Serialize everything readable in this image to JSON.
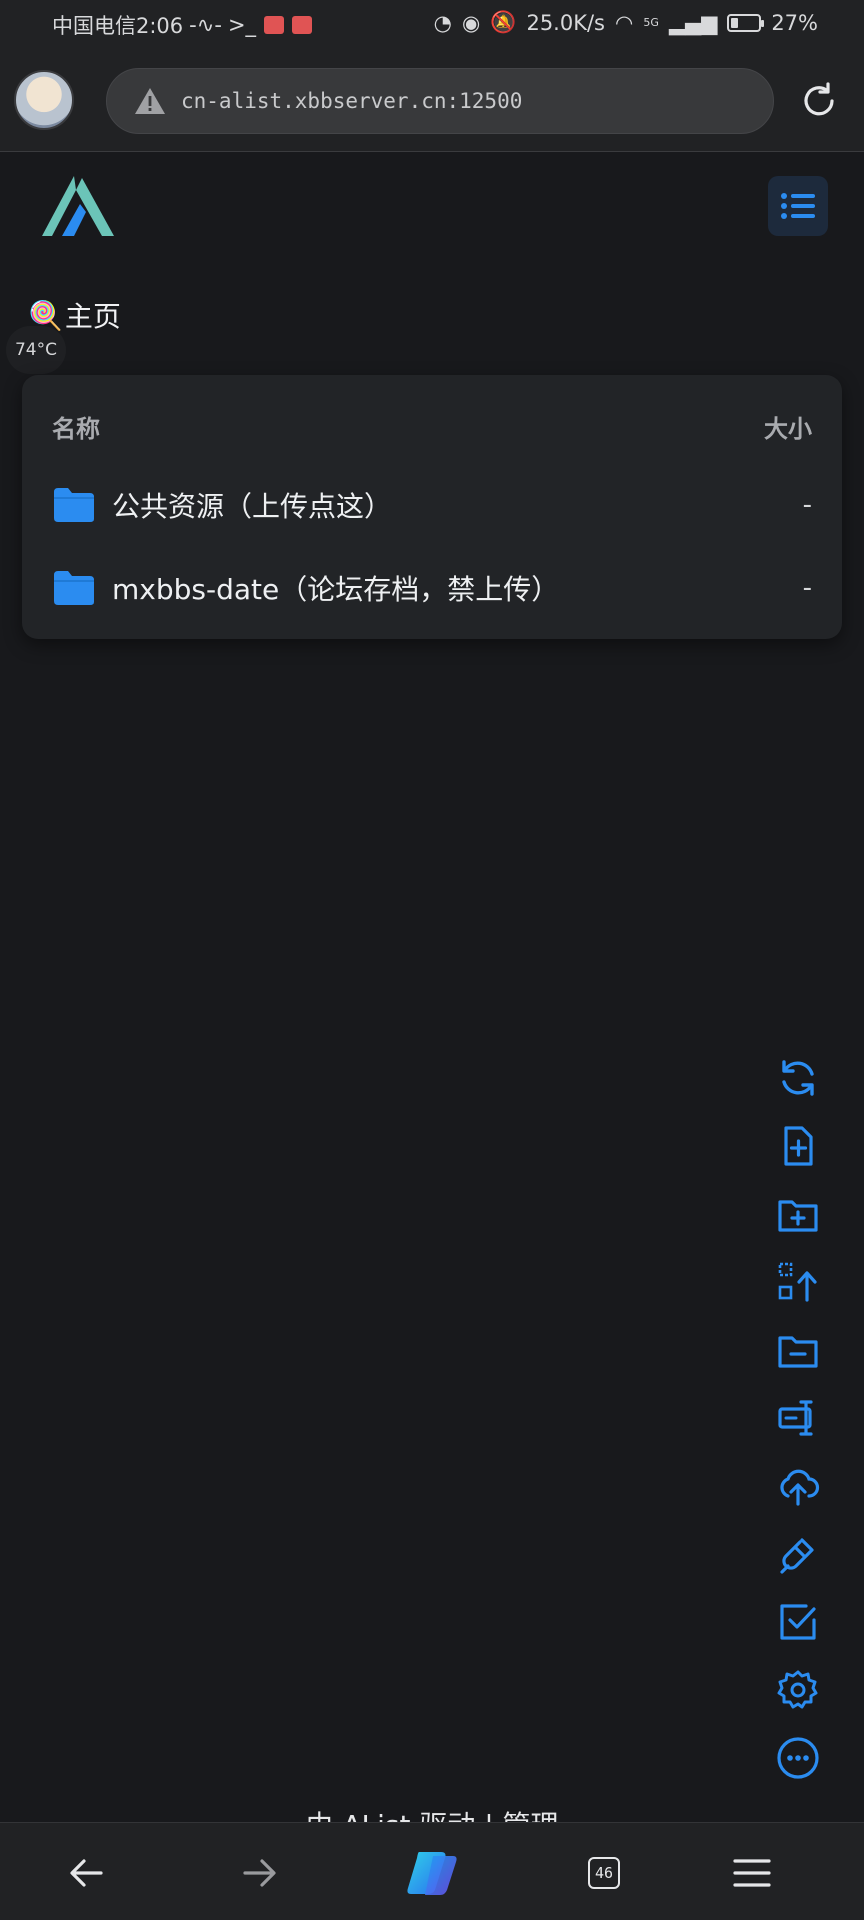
{
  "status_bar": {
    "carrier_time": "中国电信2:06",
    "network_speed": "25.0K/s",
    "network_type": "5G",
    "battery_level": "27%",
    "battery_fraction": 0.27
  },
  "browser": {
    "url": "cn-alist.xbbserver.cn:12500",
    "tabs_count": "46"
  },
  "app": {
    "breadcrumb_icon": "🍭",
    "breadcrumb": "主页",
    "temperature": "74°C",
    "columns": {
      "name": "名称",
      "size": "大小"
    },
    "files": [
      {
        "name": "公共资源（上传点这）",
        "size": "-"
      },
      {
        "name": "mxbbs-date（论坛存档，禁上传）",
        "size": "-"
      }
    ],
    "footer": "由 AList 驱动 | 管理"
  },
  "toolbar": [
    "refresh-icon",
    "new-file-icon",
    "new-folder-icon",
    "batch-select-icon",
    "folder-minus-icon",
    "rename-icon",
    "upload-cloud-icon",
    "link-icon",
    "checkbox-icon",
    "settings-icon",
    "more-icon"
  ],
  "colors": {
    "accent": "#2b8cf0",
    "background": "#18191c",
    "card": "#222427",
    "logo": "#6bc4b8"
  }
}
